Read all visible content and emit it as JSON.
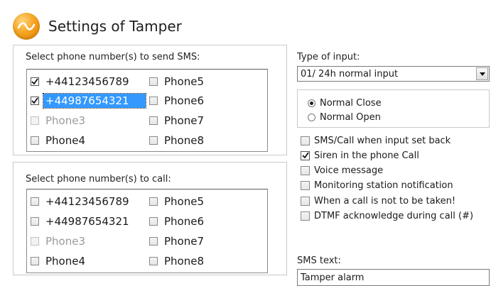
{
  "window": {
    "title": "Settings of Tamper",
    "icon": "tamper-logo-icon"
  },
  "sms_section": {
    "label": "Select phone number(s) to send SMS:",
    "phones": [
      {
        "label": "+44123456789",
        "checked": true,
        "enabled": true,
        "selected": false
      },
      {
        "label": "+44987654321",
        "checked": true,
        "enabled": true,
        "selected": true
      },
      {
        "label": "Phone3",
        "checked": false,
        "enabled": false,
        "selected": false
      },
      {
        "label": "Phone4",
        "checked": false,
        "enabled": true,
        "selected": false
      },
      {
        "label": "Phone5",
        "checked": false,
        "enabled": true,
        "selected": false
      },
      {
        "label": "Phone6",
        "checked": false,
        "enabled": true,
        "selected": false
      },
      {
        "label": "Phone7",
        "checked": false,
        "enabled": true,
        "selected": false
      },
      {
        "label": "Phone8",
        "checked": false,
        "enabled": true,
        "selected": false
      }
    ]
  },
  "call_section": {
    "label": "Select phone number(s) to call:",
    "phones": [
      {
        "label": "+44123456789",
        "checked": false,
        "enabled": true
      },
      {
        "label": "+44987654321",
        "checked": false,
        "enabled": true
      },
      {
        "label": "Phone3",
        "checked": false,
        "enabled": false
      },
      {
        "label": "Phone4",
        "checked": false,
        "enabled": true
      },
      {
        "label": "Phone5",
        "checked": false,
        "enabled": true
      },
      {
        "label": "Phone6",
        "checked": false,
        "enabled": true
      },
      {
        "label": "Phone7",
        "checked": false,
        "enabled": true
      },
      {
        "label": "Phone8",
        "checked": false,
        "enabled": true
      }
    ]
  },
  "input_type": {
    "label": "Type of input:",
    "selected": "01/ 24h normal input"
  },
  "contact_mode": {
    "options": [
      {
        "label": "Normal Close",
        "selected": true
      },
      {
        "label": "Normal Open",
        "selected": false
      }
    ]
  },
  "options": [
    {
      "label": "SMS/Call when input set back",
      "checked": false
    },
    {
      "label": "Siren in the phone Call",
      "checked": true
    },
    {
      "label": "Voice message",
      "checked": false
    },
    {
      "label": "Monitoring station notification",
      "checked": false
    },
    {
      "label": "When a call is not to be taken!",
      "checked": false
    },
    {
      "label": "DTMF acknowledge during call (#)",
      "checked": false
    }
  ],
  "sms_text": {
    "label": "SMS text:",
    "value": "Tamper alarm"
  },
  "colors": {
    "accent": "#f5a623",
    "selection": "#3399ff",
    "border": "#c9c9c9"
  }
}
